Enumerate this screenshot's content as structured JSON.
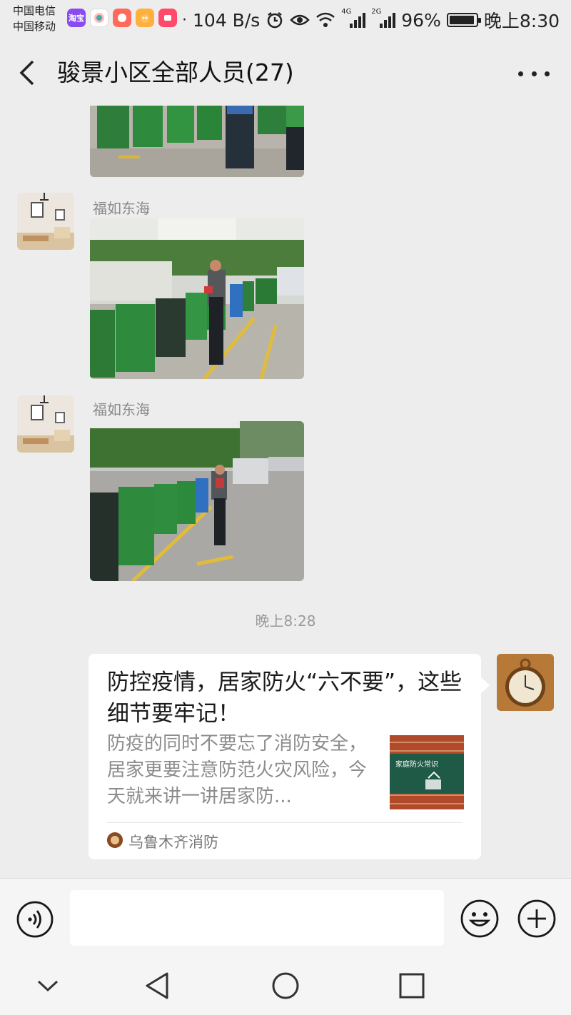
{
  "status_bar": {
    "carrier_1": "中国电信",
    "carrier_2": "中国移动",
    "net_speed": "104 B/s",
    "net_4g": "4G",
    "net_2g": "2G",
    "battery": "96%",
    "battery_level": 0.96,
    "time": "晚上8:30",
    "app_icons": [
      {
        "name": "taobao-app-icon",
        "color": "#8a4cf0",
        "text": "淘宝"
      },
      {
        "name": "weibo-app-icon",
        "color": "#ffffff"
      },
      {
        "name": "app-icon-3",
        "color": "#ff6a5a"
      },
      {
        "name": "app-icon-4",
        "color": "#ff8a3a"
      },
      {
        "name": "app-icon-5",
        "color": "#ff4a6a"
      }
    ],
    "icons": [
      "alarm-icon",
      "eye-icon",
      "wifi-icon",
      "signal-icon",
      "battery-icon"
    ]
  },
  "header": {
    "title": "骏景小区全部人员(27)",
    "back_icon": "chevron-left-icon",
    "more_icon": "more-dots-icon"
  },
  "messages": [
    {
      "type": "image",
      "description_icon": "photo-trash-bins-1"
    },
    {
      "type": "image",
      "sender": "福如东海",
      "description_icon": "photo-trash-bins-2"
    },
    {
      "type": "image",
      "sender": "福如东海",
      "description_icon": "photo-trash-bins-3"
    }
  ],
  "timestamp": "晚上8:28",
  "article_card": {
    "title": "防控疫情，居家防火“六不要”，这些细节要牢记！",
    "description": "防疫的同时不要忘了消防安全，居家更要注意防范火灾风险，今天就来讲一讲居家防...",
    "thumb_text": "家庭防火常识",
    "source": "乌鲁木齐消防"
  },
  "input_bar": {
    "placeholder": "",
    "voice_icon": "voice-icon",
    "emoji_icon": "emoji-icon",
    "plus_icon": "plus-circle-icon"
  },
  "nav_bar": {
    "icons": [
      "nav-down-icon",
      "nav-back-icon",
      "nav-home-icon",
      "nav-recents-icon"
    ]
  },
  "colors": {
    "background": "#ededed",
    "bin_green": "#2e8b3e",
    "card_bg": "#ffffff"
  }
}
